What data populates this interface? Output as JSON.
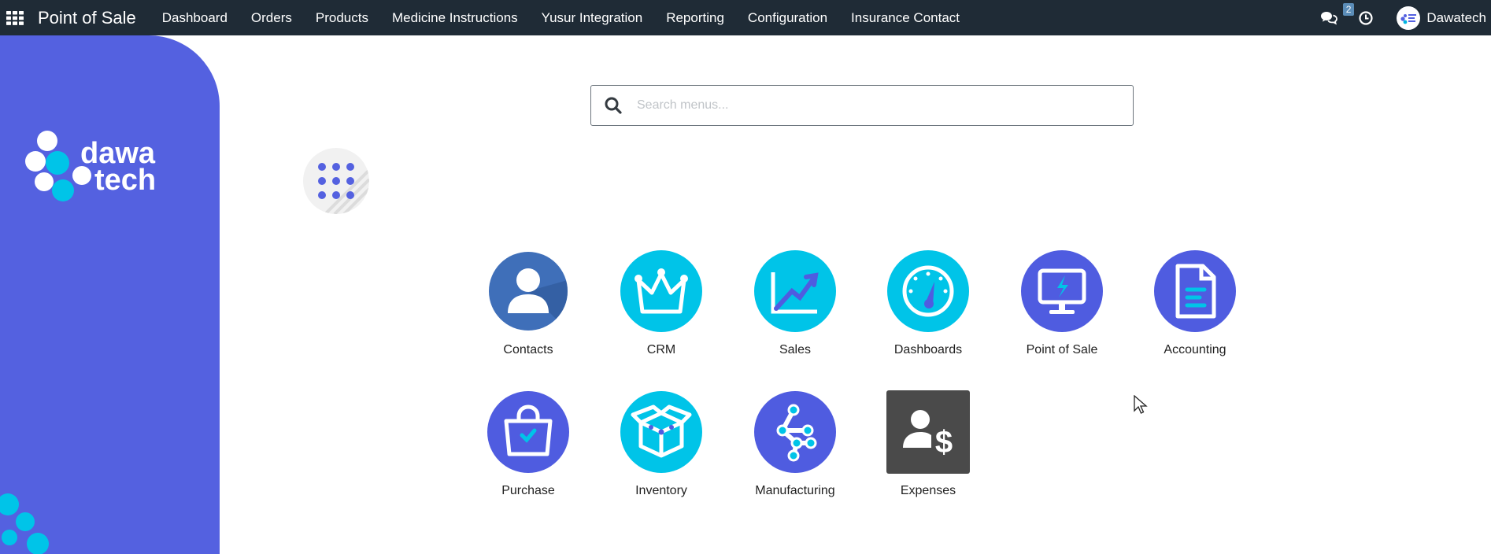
{
  "navbar": {
    "brand": "Point of Sale",
    "menu": [
      "Dashboard",
      "Orders",
      "Products",
      "Medicine Instructions",
      "Yusur Integration",
      "Reporting",
      "Configuration",
      "Insurance Contact"
    ],
    "messages_count": "2",
    "user_name": "Dawatech",
    "color": "#1f2b36"
  },
  "logo": {
    "line1": "dawa",
    "line2": "tech"
  },
  "search": {
    "placeholder": "Search menus..."
  },
  "apps": [
    {
      "label": "Contacts",
      "icon": "contacts-icon"
    },
    {
      "label": "CRM",
      "icon": "crm-crown-icon"
    },
    {
      "label": "Sales",
      "icon": "sales-chart-icon"
    },
    {
      "label": "Dashboards",
      "icon": "dashboards-gauge-icon"
    },
    {
      "label": "Point of Sale",
      "icon": "pos-monitor-icon"
    },
    {
      "label": "Accounting",
      "icon": "accounting-document-icon"
    },
    {
      "label": "Purchase",
      "icon": "purchase-bag-icon"
    },
    {
      "label": "Inventory",
      "icon": "inventory-box-icon"
    },
    {
      "label": "Manufacturing",
      "icon": "manufacturing-nodes-icon"
    },
    {
      "label": "Expenses",
      "icon": "expenses-dollar-icon"
    }
  ],
  "colors": {
    "side_panel": "#5461e0",
    "cyan": "#00c4e8",
    "indigo": "#4f5ce0",
    "contacts": "#3f6fb9",
    "expenses": "#4a4a4a"
  }
}
